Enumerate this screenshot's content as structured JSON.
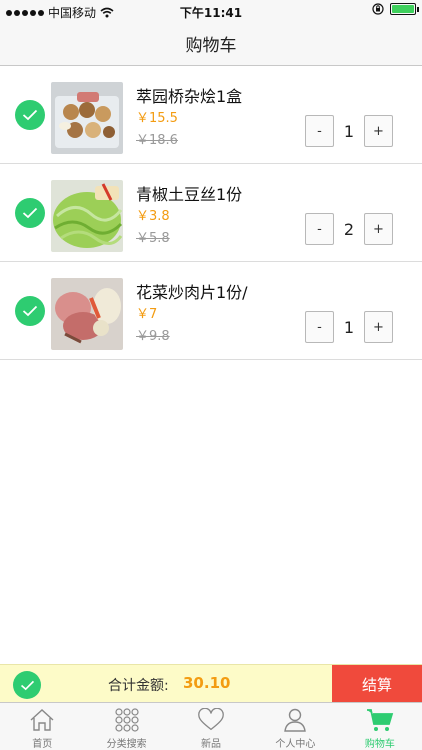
{
  "status_bar": {
    "carrier": "中国移动",
    "time": "下午11:41"
  },
  "header": {
    "title": "购物车"
  },
  "cart": {
    "items": [
      {
        "name": "萃园桥杂烩1盒",
        "price": "￥15.5",
        "old_price": "￥18.6",
        "qty": "1",
        "minus": "-",
        "plus": "+"
      },
      {
        "name": "青椒土豆丝1份",
        "price": "￥3.8",
        "old_price": "￥5.8",
        "qty": "2",
        "minus": "-",
        "plus": "+"
      },
      {
        "name": "花菜炒肉片1份/",
        "price": "￥7",
        "old_price": "￥9.8",
        "qty": "1",
        "minus": "-",
        "plus": "+"
      }
    ]
  },
  "summary": {
    "total_label": "合计金额:",
    "total_value": "30.10",
    "checkout_label": "结算"
  },
  "tabs": [
    {
      "label": "首页",
      "icon": "home-icon"
    },
    {
      "label": "分类搜索",
      "icon": "grid-icon"
    },
    {
      "label": "新品",
      "icon": "heart-icon"
    },
    {
      "label": "个人中心",
      "icon": "person-icon"
    },
    {
      "label": "购物车",
      "icon": "cart-icon"
    }
  ],
  "colors": {
    "accent_green": "#2ecc71",
    "price_orange": "#f39c12",
    "checkout_red": "#f04a3c",
    "total_bar_bg": "#fdfbc8"
  }
}
